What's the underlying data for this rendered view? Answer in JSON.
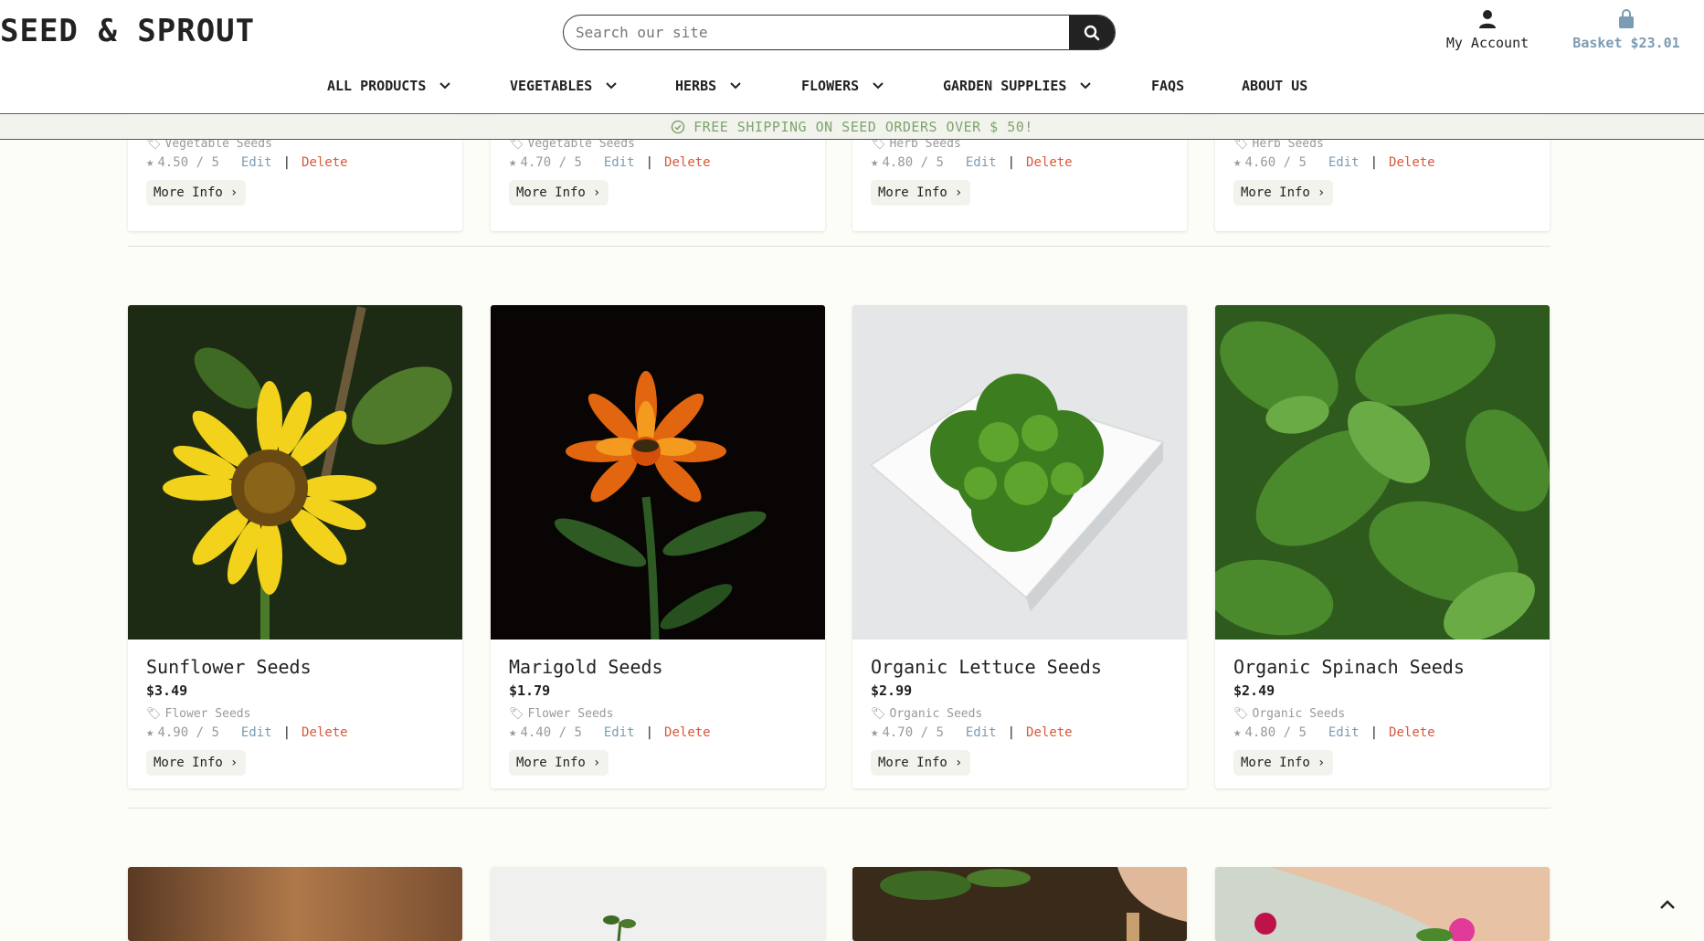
{
  "brand": {
    "logo": "SEED & SPROUT"
  },
  "search": {
    "placeholder": "Search our site"
  },
  "account": {
    "label": "My Account"
  },
  "basket": {
    "label": "Basket $23.01"
  },
  "nav": [
    {
      "label": "ALL PRODUCTS",
      "has_dropdown": true
    },
    {
      "label": "VEGETABLES",
      "has_dropdown": true
    },
    {
      "label": "HERBS",
      "has_dropdown": true
    },
    {
      "label": "FLOWERS",
      "has_dropdown": true
    },
    {
      "label": "GARDEN SUPPLIES",
      "has_dropdown": true
    },
    {
      "label": "FAQS",
      "has_dropdown": false
    },
    {
      "label": "ABOUT US",
      "has_dropdown": false
    }
  ],
  "banner": {
    "text": "FREE SHIPPING ON SEED ORDERS OVER $ 50!"
  },
  "colors": {
    "accent_blue": "#7c9cb3",
    "accent_green": "#7ea36e",
    "delete_red": "#d45a3e",
    "dark": "#222222"
  },
  "product_actions": {
    "edit": "Edit",
    "separator": "|",
    "delete": "Delete",
    "more_info": "More Info"
  },
  "top_row": [
    {
      "category": "Vegetable Seeds",
      "rating": "4.50 / 5"
    },
    {
      "category": "Vegetable Seeds",
      "rating": "4.70 / 5"
    },
    {
      "category": "Herb Seeds",
      "rating": "4.80 / 5"
    },
    {
      "category": "Herb Seeds",
      "rating": "4.60 / 5"
    }
  ],
  "products": [
    {
      "name": "Sunflower Seeds",
      "price": "$3.49",
      "category": "Flower Seeds",
      "rating": "4.90 / 5",
      "image": "sunflower-photo"
    },
    {
      "name": "Marigold Seeds",
      "price": "$1.79",
      "category": "Flower Seeds",
      "rating": "4.40 / 5",
      "image": "marigold-photo"
    },
    {
      "name": "Organic Lettuce Seeds",
      "price": "$2.99",
      "category": "Organic Seeds",
      "rating": "4.70 / 5",
      "image": "lettuce-photo"
    },
    {
      "name": "Organic Spinach Seeds",
      "price": "$2.49",
      "category": "Organic Seeds",
      "rating": "4.80 / 5",
      "image": "spinach-photo"
    }
  ],
  "bottom_row": [
    {
      "image": "wooden-texture-photo"
    },
    {
      "image": "seedling-photo"
    },
    {
      "image": "soil-planting-photo"
    },
    {
      "image": "pink-flower-photo"
    }
  ]
}
